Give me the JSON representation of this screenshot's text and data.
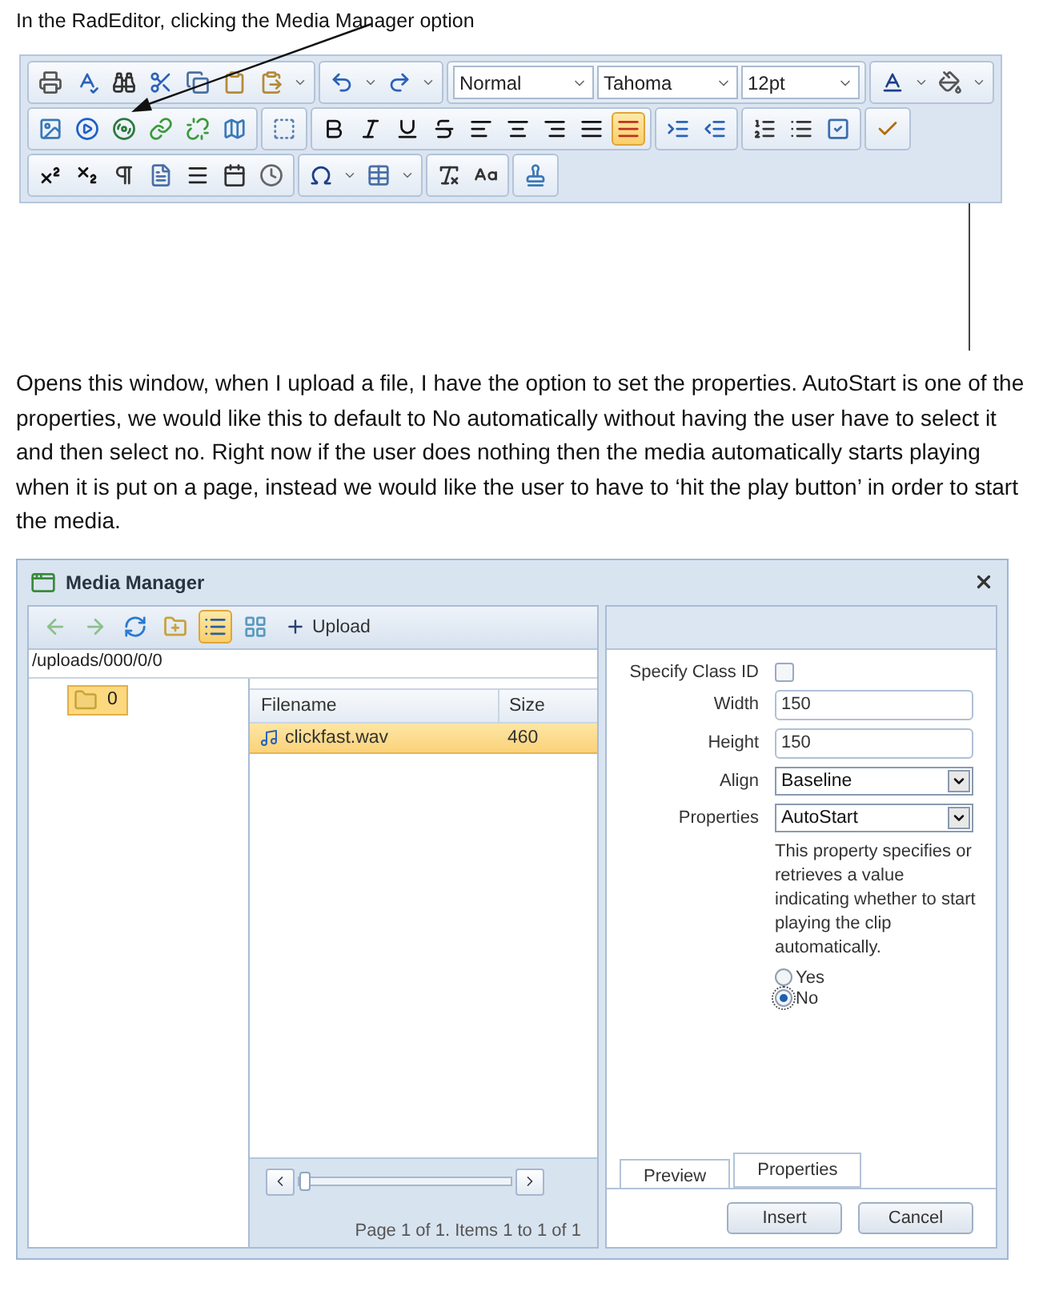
{
  "intro": "In the RadEditor, clicking the Media Manager option",
  "editor_toolbar": {
    "rows": [
      [
        {
          "items": [
            {
              "kind": "print",
              "selected": false
            },
            {
              "kind": "spellcheck",
              "selected": false
            },
            {
              "kind": "find",
              "selected": false
            },
            {
              "kind": "cut",
              "selected": false
            },
            {
              "kind": "copy",
              "selected": false
            },
            {
              "kind": "paste",
              "selected": false
            },
            {
              "kind": "pastespecial",
              "selected": false
            },
            {
              "kind": "caret",
              "selected": false
            }
          ]
        },
        {
          "items": [
            {
              "kind": "undo",
              "selected": false
            },
            {
              "kind": "caret",
              "selected": false
            },
            {
              "kind": "redo",
              "selected": false
            },
            {
              "kind": "caret",
              "selected": false
            }
          ]
        },
        {
          "items": [
            {
              "kind": "dropdown",
              "value": "Normal",
              "selected": false
            },
            {
              "kind": "dropdown",
              "value": "Tahoma",
              "selected": false
            },
            {
              "kind": "dropdown",
              "value": "12pt",
              "selected": false
            }
          ]
        },
        {
          "items": [
            {
              "kind": "fontcolor",
              "selected": false
            },
            {
              "kind": "caret",
              "selected": false
            },
            {
              "kind": "fill",
              "selected": false
            },
            {
              "kind": "caret",
              "selected": false
            }
          ]
        }
      ],
      [
        {
          "items": [
            {
              "kind": "image",
              "selected": false
            },
            {
              "kind": "media",
              "selected": false
            },
            {
              "kind": "mediamanager",
              "selected": false
            },
            {
              "kind": "link",
              "selected": false
            },
            {
              "kind": "unlink",
              "selected": false
            },
            {
              "kind": "imagemap",
              "selected": false
            }
          ]
        },
        {
          "items": [
            {
              "kind": "selectall",
              "selected": false
            }
          ]
        },
        {
          "items": [
            {
              "kind": "bold",
              "selected": false
            },
            {
              "kind": "italic",
              "selected": false
            },
            {
              "kind": "underline",
              "selected": false
            },
            {
              "kind": "strike",
              "selected": false
            },
            {
              "kind": "alignleft",
              "selected": false
            },
            {
              "kind": "aligncenter",
              "selected": false
            },
            {
              "kind": "alignright",
              "selected": false
            },
            {
              "kind": "justify",
              "selected": false
            },
            {
              "kind": "alignnone",
              "selected": true
            }
          ]
        },
        {
          "items": [
            {
              "kind": "indent",
              "selected": false
            },
            {
              "kind": "outdent",
              "selected": false
            }
          ]
        },
        {
          "items": [
            {
              "kind": "olist",
              "selected": false
            },
            {
              "kind": "ulist",
              "selected": false
            },
            {
              "kind": "checkbox",
              "selected": false
            }
          ]
        },
        {
          "items": [
            {
              "kind": "check",
              "selected": false
            }
          ]
        }
      ],
      [
        {
          "items": [
            {
              "kind": "superscript",
              "selected": false
            },
            {
              "kind": "subscript",
              "selected": false
            },
            {
              "kind": "paragraph",
              "selected": false
            },
            {
              "kind": "template",
              "selected": false
            },
            {
              "kind": "rule",
              "selected": false
            },
            {
              "kind": "date",
              "selected": false
            },
            {
              "kind": "time",
              "selected": false
            }
          ]
        },
        {
          "items": [
            {
              "kind": "symbol",
              "selected": false
            },
            {
              "kind": "caret",
              "selected": false
            },
            {
              "kind": "table",
              "selected": false
            },
            {
              "kind": "caret",
              "selected": false
            }
          ]
        },
        {
          "items": [
            {
              "kind": "stripformat",
              "selected": false
            },
            {
              "kind": "convertcase",
              "selected": false
            }
          ]
        },
        {
          "items": [
            {
              "kind": "stamp",
              "selected": false
            }
          ]
        }
      ]
    ]
  },
  "paragraph": "Opens this window, when I upload a file, I have the option to set the properties.  AutoStart is one of the properties, we would like this to default to No automatically without having the user have to select it and then select no.  Right now if the user does nothing then the media automatically starts playing when it is put on a page, instead we would like the user to have to ‘hit the play button’ in order to start the media.",
  "media_manager": {
    "title": "Media Manager",
    "toolbar": [
      {
        "kind": "back",
        "selected": false
      },
      {
        "kind": "forward",
        "selected": false
      },
      {
        "kind": "refresh",
        "selected": false
      },
      {
        "kind": "newfolder",
        "selected": false
      },
      {
        "kind": "listview",
        "selected": true
      },
      {
        "kind": "thumbview",
        "selected": false
      },
      {
        "kind": "upload",
        "label": "Upload",
        "selected": false
      }
    ],
    "path": "/uploads/000/0/0",
    "tree": [
      {
        "label": "0",
        "selected": true
      }
    ],
    "file_list": {
      "columns": [
        "Filename",
        "Size"
      ],
      "rows": [
        {
          "cells": [
            "clickfast.wav",
            "460"
          ],
          "selected": true
        }
      ]
    },
    "pager": "Page 1 of 1. Items 1 to 1 of 1",
    "properties": [
      {
        "kind": "checkbox",
        "label": "Specify Class ID",
        "checked": false
      },
      {
        "kind": "text",
        "label": "Width",
        "value": "150"
      },
      {
        "kind": "text",
        "label": "Height",
        "value": "150"
      },
      {
        "kind": "select",
        "label": "Align",
        "value": "Baseline"
      },
      {
        "kind": "select",
        "label": "Properties",
        "value": "AutoStart"
      }
    ],
    "description": "This property specifies or retrieves a value indicating whether to start playing the clip automatically.",
    "options": [
      {
        "label": "Yes",
        "selected": false
      },
      {
        "label": "No",
        "selected": true
      }
    ],
    "tabs": [
      {
        "label": "Preview",
        "selected": false
      },
      {
        "label": "Properties",
        "selected": true
      }
    ],
    "buttons": [
      "Insert",
      "Cancel"
    ]
  }
}
